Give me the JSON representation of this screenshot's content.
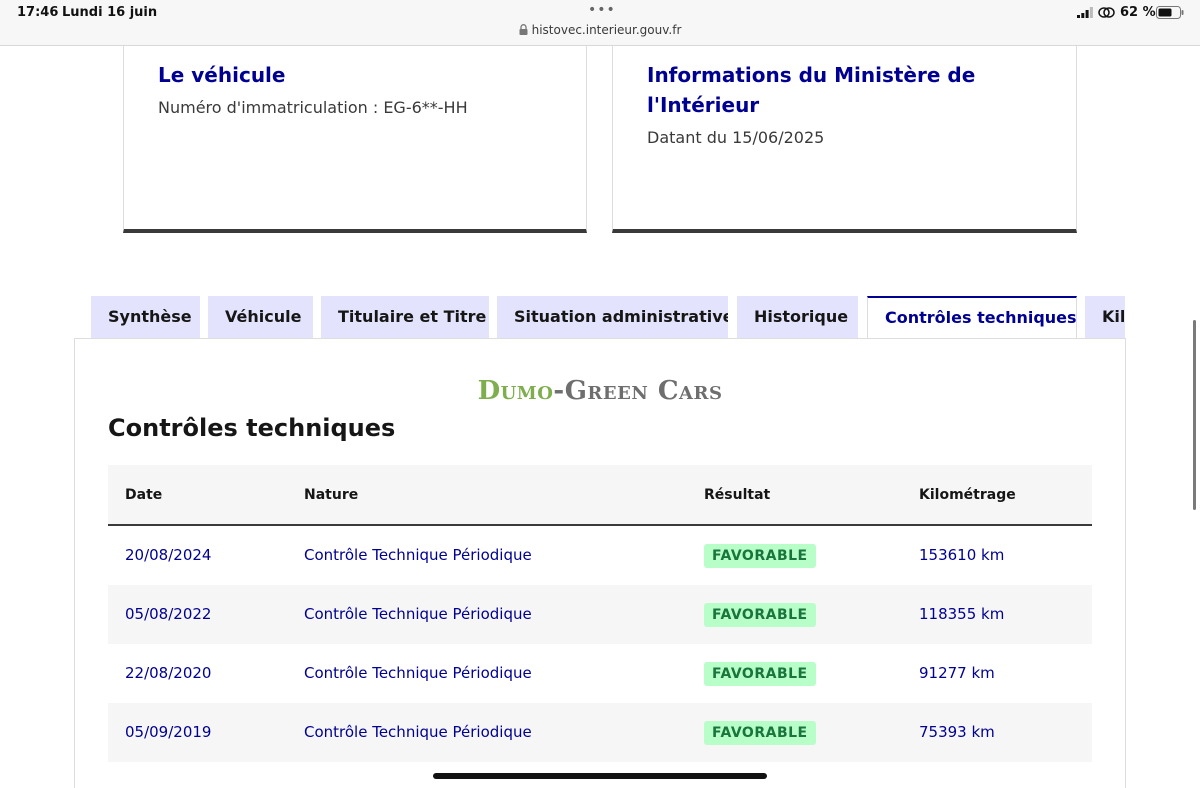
{
  "status_bar": {
    "time": "17:46",
    "date": "Lundi 16 juin",
    "url": "histovec.interieur.gouv.fr",
    "battery": "62 %"
  },
  "cards": {
    "vehicle": {
      "title": "Le véhicule",
      "subtitle": "Numéro d'immatriculation : EG-6**-HH"
    },
    "ministry": {
      "title": "Informations du Ministère de l'Intérieur",
      "subtitle": "Datant du 15/06/2025"
    }
  },
  "tabs": [
    {
      "label": "Synthèse",
      "active": false
    },
    {
      "label": "Véhicule",
      "active": false
    },
    {
      "label": "Titulaire et Titre",
      "active": false
    },
    {
      "label": "Situation administrative",
      "active": false
    },
    {
      "label": "Historique",
      "active": false
    },
    {
      "label": "Contrôles techniques",
      "active": true
    },
    {
      "label": "Kilométrage",
      "active": false
    }
  ],
  "watermark": {
    "part1": "Dumo",
    "part2": "-Green Cars"
  },
  "section": {
    "title": "Contrôles techniques"
  },
  "table": {
    "headers": [
      "Date",
      "Nature",
      "Résultat",
      "Kilométrage"
    ],
    "rows": [
      {
        "date": "20/08/2024",
        "nature": "Contrôle Technique Périodique",
        "result": "FAVORABLE",
        "km": "153610 km"
      },
      {
        "date": "05/08/2022",
        "nature": "Contrôle Technique Périodique",
        "result": "FAVORABLE",
        "km": "118355 km"
      },
      {
        "date": "22/08/2020",
        "nature": "Contrôle Technique Périodique",
        "result": "FAVORABLE",
        "km": "91277 km"
      },
      {
        "date": "05/09/2019",
        "nature": "Contrôle Technique Périodique",
        "result": "FAVORABLE",
        "km": "75393 km"
      }
    ]
  },
  "colors": {
    "accent": "#000091",
    "tab_bg": "#e3e3fd",
    "badge_bg": "#b8fec9",
    "badge_text": "#18753c",
    "watermark_green": "#7fae4e"
  }
}
